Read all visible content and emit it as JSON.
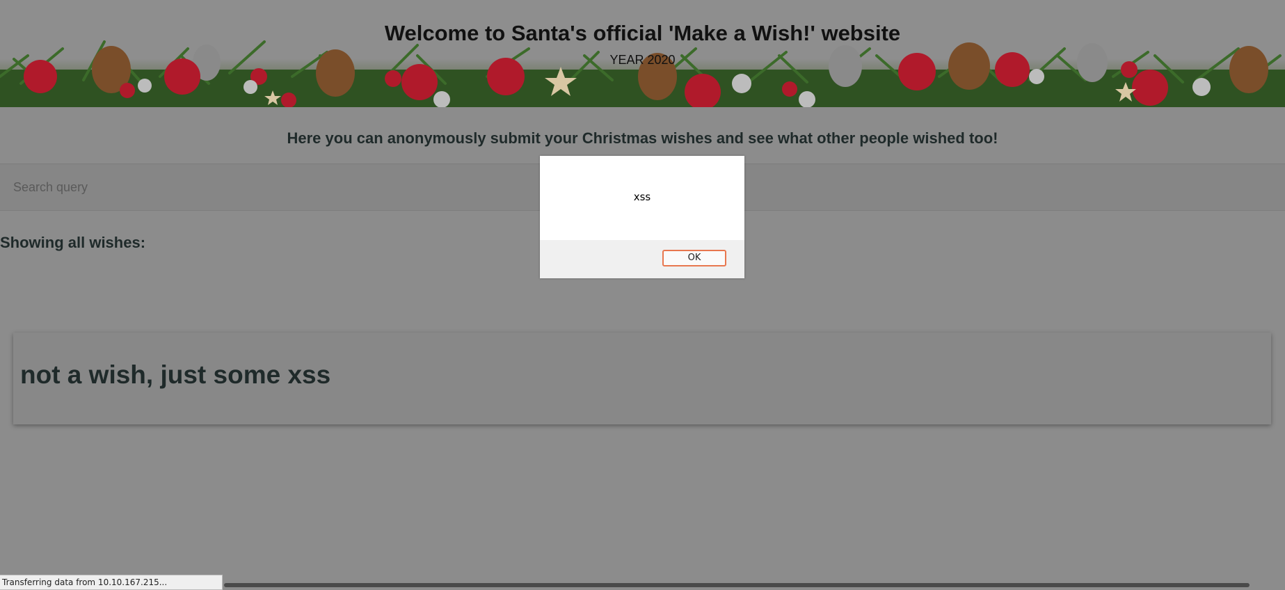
{
  "banner": {
    "title": "Welcome to Santa's official 'Make a Wish!' website",
    "year": "YEAR 2020"
  },
  "tagline": "Here you can anonymously submit your Christmas wishes and see what other people wished too!",
  "search": {
    "placeholder": "Search query",
    "value": ""
  },
  "wishes_section": {
    "heading": "Showing all wishes:",
    "items": [
      {
        "text": "not a wish, just some xss"
      }
    ]
  },
  "alert_dialog": {
    "message": "xss",
    "ok_label": "OK"
  },
  "status_bar": {
    "text": "Transferring data from 10.10.167.215..."
  },
  "colors": {
    "overlay_gray": "#8c8c8c",
    "ok_button_focus": "#e8774f",
    "ornament_red": "#b01a2b",
    "pine_green": "#3c6b2a",
    "pinecone_brown": "#7a4e2a"
  }
}
